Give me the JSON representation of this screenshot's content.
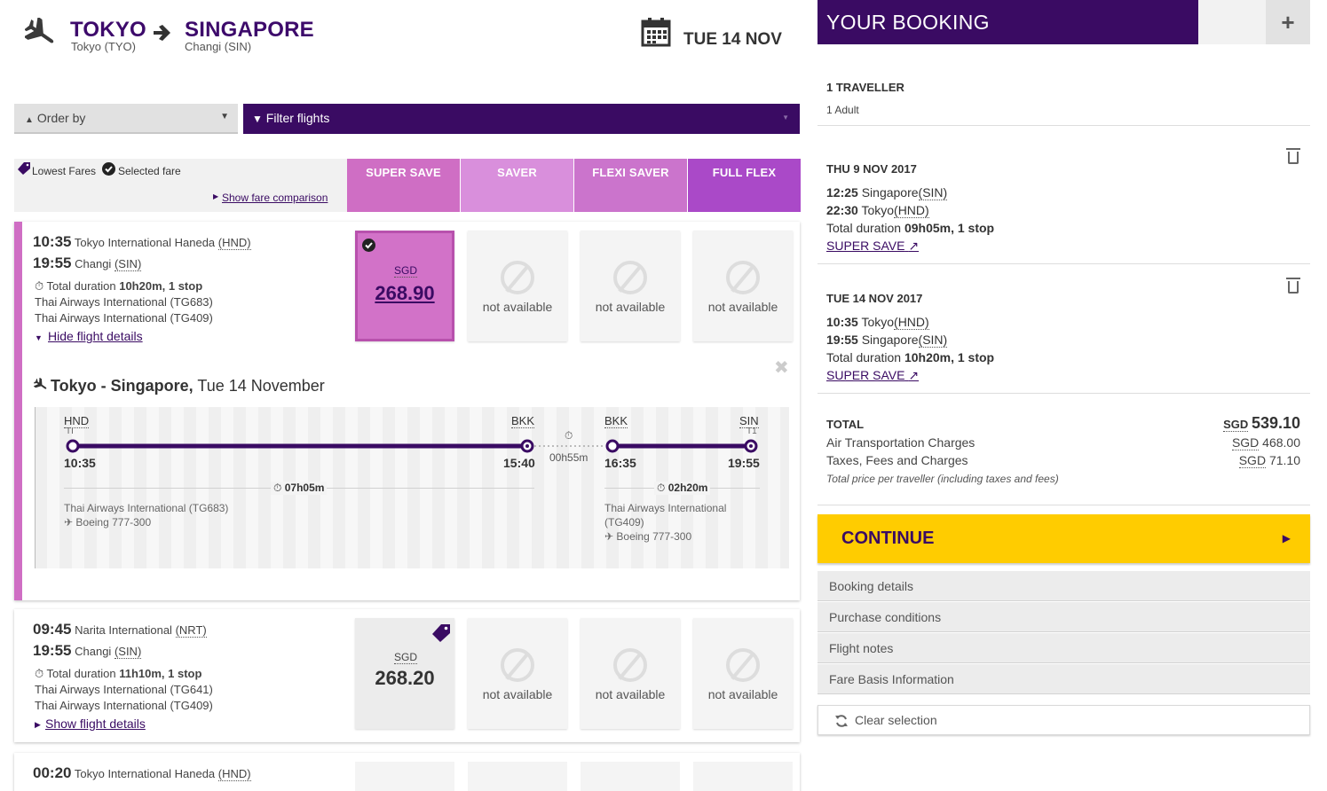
{
  "header": {
    "origin_city": "TOKYO",
    "origin_sub": "Tokyo (TYO)",
    "destination_city": "SINGAPORE",
    "destination_sub": "Changi (SIN)",
    "date": "TUE 14 NOV"
  },
  "toolbar": {
    "order_by": "Order by",
    "filter": "Filter flights"
  },
  "legend": {
    "lowest_fares": "Lowest Fares",
    "selected_fare": "Selected fare",
    "show_comparison": "Show fare comparison"
  },
  "fare_classes": [
    {
      "label": "SUPER SAVE",
      "color": "#cf6ec4"
    },
    {
      "label": "SAVER",
      "color": "#d98fdc"
    },
    {
      "label": "FLEXI SAVER",
      "color": "#cb74cc"
    },
    {
      "label": "FULL FLEX",
      "color": "#aa49c8"
    }
  ],
  "flights": [
    {
      "dep_time": "10:35",
      "dep_airport": "Tokyo International Haneda",
      "dep_code": "(HND)",
      "arr_time": "19:55",
      "arr_airport": "Changi",
      "arr_code": "(SIN)",
      "duration_label": "Total duration",
      "duration": "10h20m, 1 stop",
      "carrier1": "Thai Airways International (TG683)",
      "carrier2": "Thai Airways International (TG409)",
      "details_link": "Hide flight details",
      "fare_currency": "SGD",
      "fare_price": "268.90",
      "na": "not available"
    },
    {
      "dep_time": "09:45",
      "dep_airport": "Narita International",
      "dep_code": "(NRT)",
      "arr_time": "19:55",
      "arr_airport": "Changi",
      "arr_code": "(SIN)",
      "duration_label": "Total duration",
      "duration": "11h10m, 1 stop",
      "carrier1": "Thai Airways International (TG641)",
      "carrier2": "Thai Airways International (TG409)",
      "details_link": "Show flight details",
      "fare_currency": "SGD",
      "fare_price": "268.20",
      "na": "not available"
    },
    {
      "dep_time": "00:20",
      "dep_airport": "Tokyo International Haneda",
      "dep_code": "(HND)"
    }
  ],
  "details": {
    "title_route": "Tokyo - Singapore,",
    "title_date": "Tue 14 November",
    "seg1": {
      "from": "HND",
      "from_term": "TI",
      "to": "BKK",
      "dep": "10:35",
      "arr": "15:40",
      "duration": "07h05m",
      "carrier": "Thai Airways International (TG683)",
      "aircraft": "Boeing 777-300"
    },
    "layover": "00h55m",
    "seg2": {
      "from": "BKK",
      "to": "SIN",
      "to_term": "T1",
      "dep": "16:35",
      "arr": "19:55",
      "duration": "02h20m",
      "carrier_a": "Thai Airways International",
      "carrier_b": "(TG409)",
      "aircraft": "Boeing 777-300"
    }
  },
  "booking": {
    "title": "YOUR BOOKING",
    "plus": "+",
    "travellers": "1 TRAVELLER",
    "travellers_sub": "1 Adult",
    "legs": [
      {
        "date": "THU 9 NOV 2017",
        "dep_time": "12:25",
        "dep_city": "Singapore",
        "dep_code": "(SIN)",
        "arr_time": "22:30",
        "arr_city": "Tokyo",
        "arr_code": "(HND)",
        "duration_label": "Total duration",
        "duration": "09h05m, 1 stop",
        "fare": "SUPER SAVE"
      },
      {
        "date": "TUE 14 NOV 2017",
        "dep_time": "10:35",
        "dep_city": "Tokyo",
        "dep_code": "(HND)",
        "arr_time": "19:55",
        "arr_city": "Singapore",
        "arr_code": "(SIN)",
        "duration_label": "Total duration",
        "duration": "10h20m, 1 stop",
        "fare": "SUPER SAVE"
      }
    ],
    "total_label": "TOTAL",
    "total_currency": "SGD",
    "total_value": "539.10",
    "air_label": "Air Transportation Charges",
    "air_currency": "SGD",
    "air_value": "468.00",
    "tax_label": "Taxes, Fees and Charges",
    "tax_currency": "SGD",
    "tax_value": "71.10",
    "note": "Total price per traveller (including taxes and fees)",
    "continue": "CONTINUE",
    "links": [
      "Booking details",
      "Purchase conditions",
      "Flight notes",
      "Fare Basis Information"
    ],
    "clear": "Clear selection"
  }
}
